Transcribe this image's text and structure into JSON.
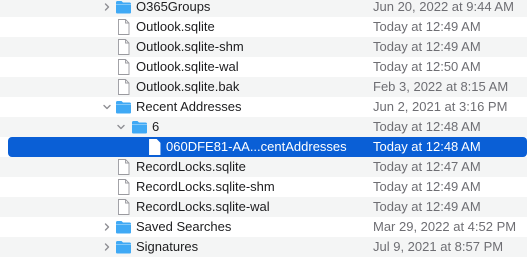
{
  "colors": {
    "folder": "#3fa9f5",
    "selection": "#0a5fd6",
    "stripe": "#f4f5f5",
    "date_text": "#6e6e73"
  },
  "rows": [
    {
      "name": "O365Groups",
      "date": "Jun 20, 2022 at 9:44 AM",
      "kind": "folder",
      "level": 1,
      "disclosure": "collapsed",
      "striped": true,
      "selected": false
    },
    {
      "name": "Outlook.sqlite",
      "date": "Today at 12:49 AM",
      "kind": "file",
      "level": 1,
      "disclosure": "none",
      "striped": false,
      "selected": false
    },
    {
      "name": "Outlook.sqlite-shm",
      "date": "Today at 12:49 AM",
      "kind": "file",
      "level": 1,
      "disclosure": "none",
      "striped": true,
      "selected": false
    },
    {
      "name": "Outlook.sqlite-wal",
      "date": "Today at 12:50 AM",
      "kind": "file",
      "level": 1,
      "disclosure": "none",
      "striped": false,
      "selected": false
    },
    {
      "name": "Outlook.sqlite.bak",
      "date": "Feb 3, 2022 at 8:15 AM",
      "kind": "file",
      "level": 1,
      "disclosure": "none",
      "striped": true,
      "selected": false
    },
    {
      "name": "Recent Addresses",
      "date": "Jun 2, 2021 at 3:16 PM",
      "kind": "folder",
      "level": 1,
      "disclosure": "expanded",
      "striped": false,
      "selected": false
    },
    {
      "name": "6",
      "date": "Today at 12:48 AM",
      "kind": "folder",
      "level": 2,
      "disclosure": "expanded",
      "striped": true,
      "selected": false
    },
    {
      "name": "060DFE81-AA...centAddresses",
      "date": "Today at 12:48 AM",
      "kind": "file",
      "level": 3,
      "disclosure": "none",
      "striped": false,
      "selected": true
    },
    {
      "name": "RecordLocks.sqlite",
      "date": "Today at 12:47 AM",
      "kind": "file",
      "level": 1,
      "disclosure": "none",
      "striped": true,
      "selected": false
    },
    {
      "name": "RecordLocks.sqlite-shm",
      "date": "Today at 12:49 AM",
      "kind": "file",
      "level": 1,
      "disclosure": "none",
      "striped": false,
      "selected": false
    },
    {
      "name": "RecordLocks.sqlite-wal",
      "date": "Today at 12:49 AM",
      "kind": "file",
      "level": 1,
      "disclosure": "none",
      "striped": true,
      "selected": false
    },
    {
      "name": "Saved Searches",
      "date": "Mar 29, 2022 at 4:52 PM",
      "kind": "folder",
      "level": 1,
      "disclosure": "collapsed",
      "striped": false,
      "selected": false
    },
    {
      "name": "Signatures",
      "date": "Jul 9, 2021 at 8:57 PM",
      "kind": "folder",
      "level": 1,
      "disclosure": "collapsed",
      "striped": true,
      "selected": false
    }
  ]
}
